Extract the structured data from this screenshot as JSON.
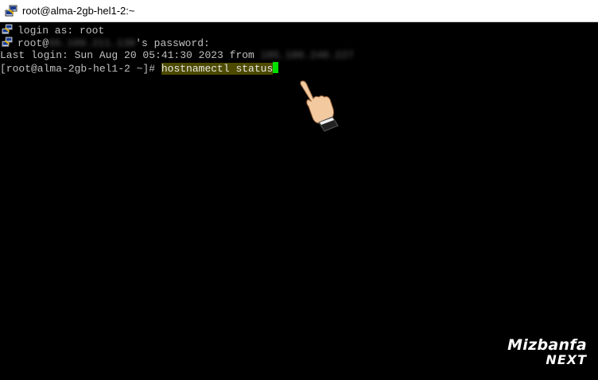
{
  "window": {
    "title": "root@alma-2gb-hel1-2:~",
    "icon": "putty-icon"
  },
  "terminal": {
    "line1": {
      "icon": "putty-icon",
      "text": "login as: root"
    },
    "line2": {
      "icon": "putty-icon",
      "prefix": "root@",
      "redacted": "65.109.211.130",
      "suffix": "'s password:"
    },
    "line3": {
      "prefix": "Last login: Sun Aug 20 05:41:30 2023 from ",
      "redacted": "185.186.240.227"
    },
    "line4": {
      "prompt": "[root@alma-2gb-hel1-2 ~]# ",
      "command": "hostnamectl status"
    },
    "cursor_color": "#00e000",
    "highlight_color": "#4d4a00"
  },
  "watermark": {
    "brand": "Mizbanfa",
    "sub": "NEXT"
  },
  "pointer": {
    "icon": "pointing-hand-icon"
  }
}
